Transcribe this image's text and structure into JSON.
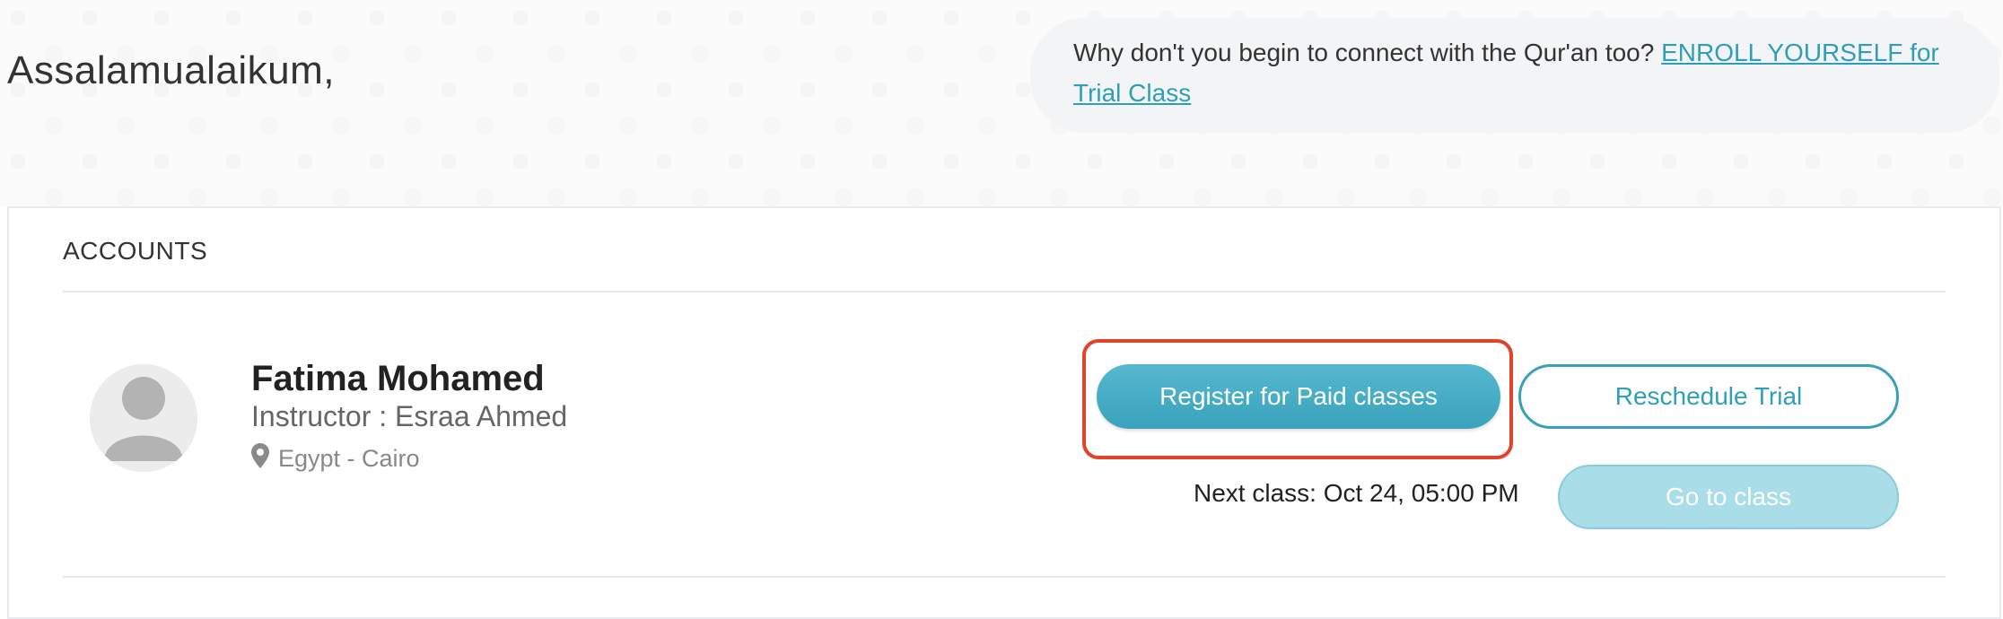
{
  "header": {
    "greeting": "Assalamualaikum,",
    "cta": {
      "text": "Why don't you begin to connect with the Qur'an too? ",
      "link_label": "ENROLL YOURSELF for Trial Class"
    }
  },
  "accounts": {
    "heading": "ACCOUNTS",
    "student": {
      "name": "Fatima Mohamed",
      "instructor": "Instructor : Esraa Ahmed",
      "location": "Egypt - Cairo"
    },
    "actions": {
      "register_label": "Register for Paid classes",
      "reschedule_label": "Reschedule Trial",
      "next_class": "Next class: Oct 24, 05:00 PM",
      "go_to_class_label": "Go to class"
    }
  },
  "icons": {
    "avatar": "user-placeholder-icon",
    "location": "map-pin-icon"
  },
  "colors": {
    "accent": "#3aa2bd",
    "highlight": "#e2432b",
    "disabled": "#a9dde8"
  }
}
